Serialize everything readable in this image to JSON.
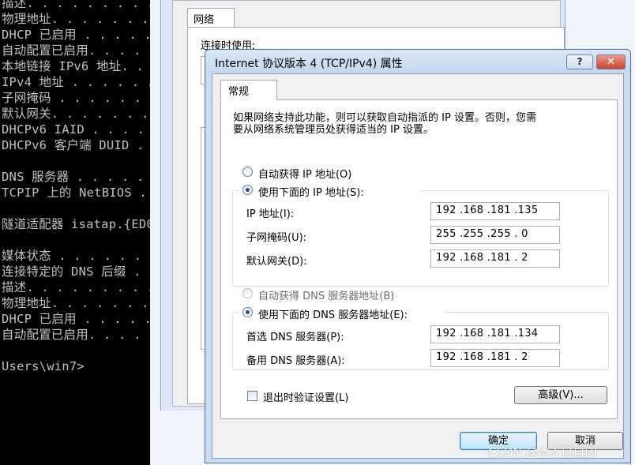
{
  "console": {
    "lines": [
      "描述. . . . . . . . . . . . . . .",
      "物理地址. . . . . . . . . . . . .",
      "DHCP 已启用 . . . . . . . . . . .",
      "自动配置已启用. . . . . . . . . .",
      "本地链接 IPv6 地址. . . . . . . .",
      "IPv4 地址 . . . . . . . . . . . .",
      "子网掩码 . . . . . . . . . . . .",
      "默认网关. . . . . . . . . . . . .",
      "DHCPv6 IAID . . . . . . . . . . .",
      "DHCPv6 客户端 DUID . . . . . . .",
      "",
      "DNS 服务器 . . . . . . . . . . .",
      "TCPIP 上的 NetBIOS . . . . . . .",
      "",
      "隧道适配器 isatap.{ED0",
      "",
      "媒体状态 . . . . . . . . . . . .",
      "连接特定的 DNS 后缀 . . . . . . .",
      "描述. . . . . . . . . . . . . . .",
      "物理地址. . . . . . . . . . . . .",
      "DHCP 已启用 . . . . . . . . . . .",
      "自动配置已启用. . . . . . . . . .",
      "",
      "Users\\win7>"
    ]
  },
  "background_window": {
    "tab_label": "网络",
    "connect_using_label": "连接时使用:"
  },
  "dialog": {
    "title": "Internet 协议版本 4 (TCP/IPv4) 属性",
    "help_label": "?",
    "close_label": "✕",
    "tab_general": "常规",
    "description": [
      "如果网络支持此功能，则可以获取自动指派的 IP 设置。否则，您需",
      "要从网络系统管理员处获得适当的 IP 设置。"
    ],
    "ip_auto_label": "自动获得 IP 地址(O)",
    "ip_manual_label": "使用下面的 IP 地址(S):",
    "ip_address_label": "IP 地址(I):",
    "ip_address_value": "192 .168 .181 .135",
    "subnet_label": "子网掩码(U):",
    "subnet_value": "255 .255 .255 . 0",
    "gateway_label": "默认网关(D):",
    "gateway_value": "192 .168 .181 . 2",
    "dns_auto_label": "自动获得 DNS 服务器地址(B)",
    "dns_manual_label": "使用下面的 DNS 服务器地址(E):",
    "preferred_dns_label": "首选 DNS 服务器(P):",
    "preferred_dns_value": "192 .168 .181 .134",
    "alternate_dns_label": "备用 DNS 服务器(A):",
    "alternate_dns_value": "192 .168 .181 . 2",
    "validate_label": "退出时验证设置(L)",
    "advanced_label": "高级(V)...",
    "ok_label": "确定",
    "cancel_label": "取消",
    "ip_mode": "manual",
    "dns_mode": "manual",
    "validate_checked": false
  },
  "watermark": "CSDN @本人已自闭"
}
